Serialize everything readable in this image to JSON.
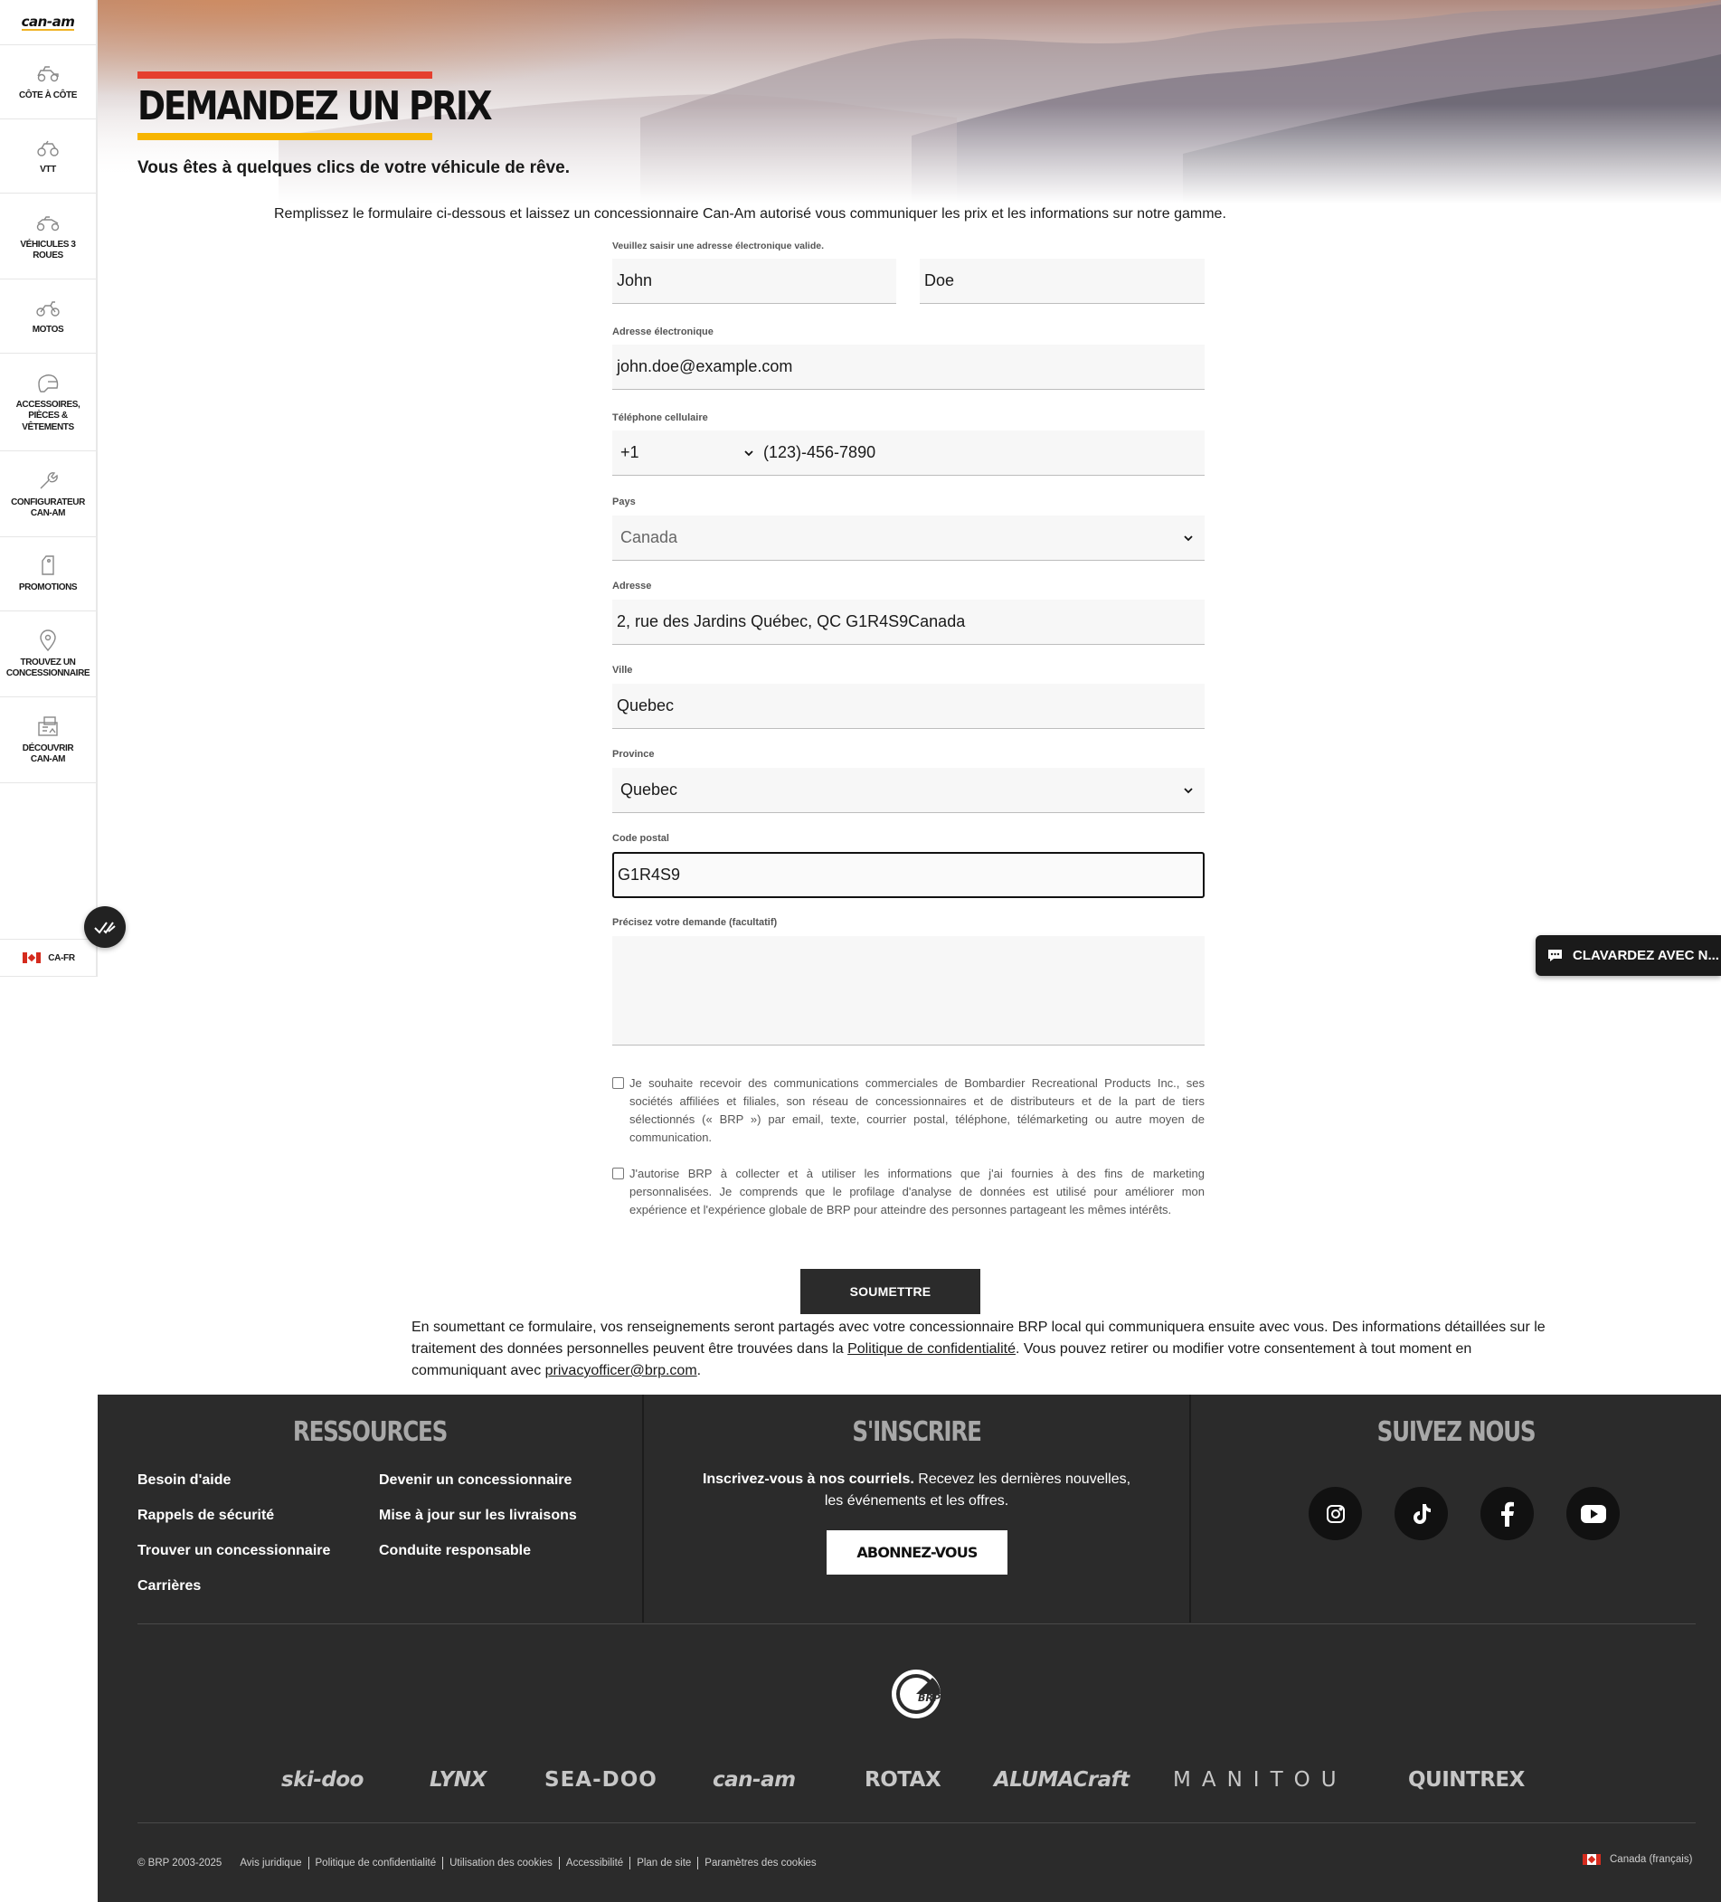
{
  "sidebar": {
    "logo": "can-am",
    "items": [
      {
        "label": "CÔTE À CÔTE",
        "icon": "ssv-icon"
      },
      {
        "label": "VTT",
        "icon": "atv-icon"
      },
      {
        "label": "VÉHICULES 3 ROUES",
        "icon": "three-wheel-icon"
      },
      {
        "label": "MOTOS",
        "icon": "motorcycle-icon"
      },
      {
        "label": "ACCESSOIRES, PIÈCES & VÊTEMENTS",
        "icon": "helmet-icon"
      },
      {
        "label": "CONFIGURATEUR CAN-AM",
        "icon": "wrench-icon"
      },
      {
        "label": "PROMOTIONS",
        "icon": "tag-icon"
      },
      {
        "label": "TROUVEZ UN CONCESSIONNAIRE",
        "icon": "location-pin-icon"
      },
      {
        "label": "DÉCOUVRIR CAN-AM",
        "icon": "discover-icon"
      }
    ],
    "locale": "CA-FR"
  },
  "hero": {
    "title": "DEMANDEZ UN PRIX",
    "subtitle": "Vous êtes à quelques clics de votre véhicule de rêve."
  },
  "intro": "Remplissez le formulaire ci-dessous et laissez un concessionnaire Can-Am autorisé vous communiquer les prix et les informations sur notre gamme.",
  "form": {
    "name_error": "Veuillez saisir une adresse électronique valide.",
    "first_name": "John",
    "last_name": "Doe",
    "email_label": "Adresse électronique",
    "email": "john.doe@example.com",
    "phone_label": "Téléphone cellulaire",
    "phone_code": "+1",
    "phone": "(123)-456-7890",
    "country_label": "Pays",
    "country": "Canada",
    "address_label": "Adresse",
    "address": "2, rue des Jardins Québec, QC G1R4S9Canada",
    "city_label": "Ville",
    "city": "Quebec",
    "province_label": "Province",
    "province": "Quebec",
    "postal_label": "Code postal",
    "postal": "G1R4S9",
    "request_label": "Précisez votre demande (facultatif)",
    "request": "",
    "consent1": "Je souhaite recevoir des communications commerciales de Bombardier Recreational Products Inc., ses sociétés affiliées et filiales, son réseau de concessionnaires et de distributeurs et de la part de tiers sélectionnés (« BRP ») par email, texte, courrier postal, téléphone, télémarketing ou autre moyen de communication.",
    "consent2": "J'autorise BRP à collecter et à utiliser les informations que j'ai fournies à des fins de marketing personnalisées. Je comprends que le profilage d'analyse de données est utilisé pour améliorer mon expérience et l'expérience globale de BRP pour atteindre des personnes partageant les mêmes intérêts.",
    "submit": "SOUMETTRE"
  },
  "legal": {
    "part1": "En soumettant ce formulaire, vos renseignements seront partagés avec votre concessionnaire BRP local qui communiquera ensuite avec vous. Des informations détaillées sur le traitement des données personnelles peuvent être trouvées dans la ",
    "link1": "Politique de confidentialité",
    "part2": ". Vous pouvez retirer ou modifier votre consentement à tout moment en communiquant avec ",
    "link2": "privacyofficer@brp.com",
    "part3": "."
  },
  "chat": {
    "label": "CLAVARDEZ AVEC N..."
  },
  "footer": {
    "resources_title": "RESSOURCES",
    "resources": [
      "Besoin d'aide",
      "Rappels de sécurité",
      "Trouver un concessionnaire",
      "Carrières",
      "Devenir un concessionnaire",
      "Mise à jour sur les livraisons",
      "Conduite responsable"
    ],
    "subscribe_title": "S'INSCRIRE",
    "subscribe_bold": "Inscrivez-vous à nos courriels.",
    "subscribe_text": " Recevez les dernières nouvelles, les événements et les offres.",
    "subscribe_button": "ABONNEZ-VOUS",
    "follow_title": "SUIVEZ NOUS",
    "socials": [
      "instagram-icon",
      "tiktok-icon",
      "facebook-icon",
      "youtube-icon"
    ],
    "brp_logo": "BRP",
    "brands": [
      "ski-doo",
      "LYNX",
      "SEA-DOO",
      "can-am",
      "ROTAX",
      "ALUMACraft",
      "MANITOU",
      "QUINTREX"
    ],
    "copyright": "© BRP 2003-2025",
    "legal_links": [
      "Avis juridique",
      "Politique de confidentialité",
      "Utilisation des cookies",
      "Accessibilité",
      "Plan de site",
      "Paramètres des cookies"
    ],
    "region": "Canada (français)"
  },
  "colors": {
    "accent_red": "#e53f2e",
    "accent_yellow": "#f7b500",
    "footer_bg": "#2b2b2b"
  }
}
